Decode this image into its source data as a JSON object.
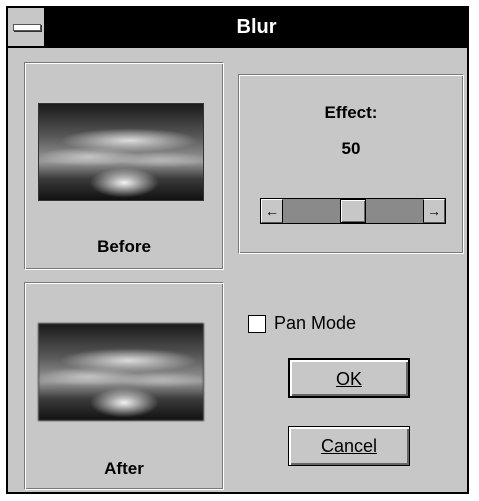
{
  "window": {
    "title": "Blur"
  },
  "preview": {
    "before_label": "Before",
    "after_label": "After"
  },
  "effect": {
    "label": "Effect:",
    "value": "50",
    "slider_level_percent": 50,
    "left_arrow": "←",
    "right_arrow": "→"
  },
  "options": {
    "pan_mode_label": "Pan Mode",
    "pan_mode_checked": false
  },
  "buttons": {
    "ok_label": "OK",
    "cancel_label": "Cancel"
  },
  "icons": {
    "system_menu": "system-menu-icon",
    "scroll_left": "left-arrow-icon",
    "scroll_right": "right-arrow-icon"
  },
  "colors": {
    "face": "#c7c7c7",
    "titlebar": "#000000",
    "title_text": "#ffffff"
  }
}
